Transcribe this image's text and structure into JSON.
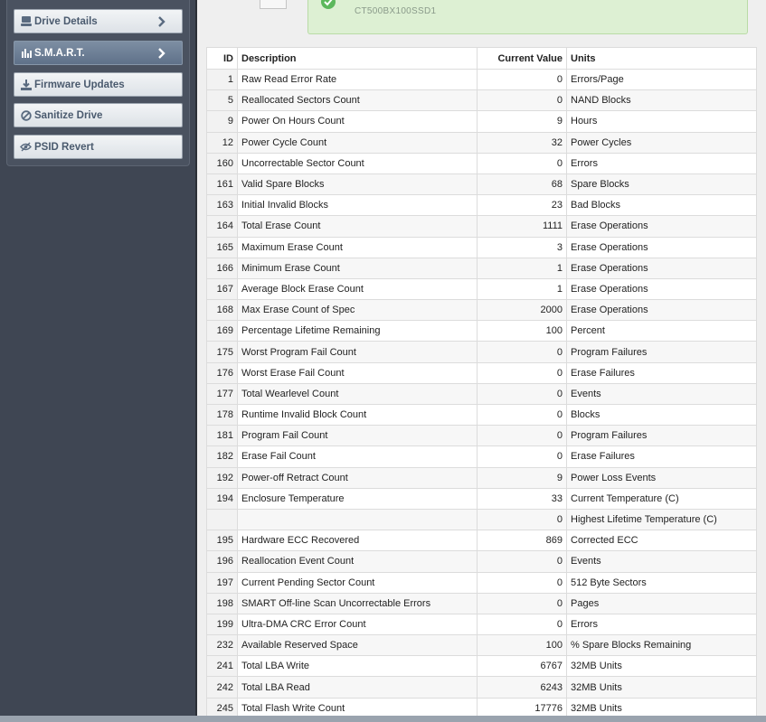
{
  "sidebar": {
    "items": [
      {
        "label": "Drive Details",
        "icon": "drive-icon",
        "has_chevron": true,
        "active": false
      },
      {
        "label": "S.M.A.R.T.",
        "icon": "bar-chart-icon",
        "has_chevron": true,
        "active": true
      },
      {
        "label": "Firmware Updates",
        "icon": "download-icon",
        "has_chevron": false,
        "active": false
      },
      {
        "label": "Sanitize Drive",
        "icon": "prohibited-icon",
        "has_chevron": false,
        "active": false
      },
      {
        "label": "PSID Revert",
        "icon": "eye-slash-icon",
        "has_chevron": false,
        "active": false
      }
    ]
  },
  "status": {
    "model": "CT500BX100SSD1",
    "color": "#ddf0d3"
  },
  "table": {
    "headers": {
      "id": "ID",
      "description": "Description",
      "value": "Current Value",
      "units": "Units"
    },
    "rows": [
      {
        "id": "1",
        "description": "Raw Read Error Rate",
        "value": "0",
        "units": "Errors/Page"
      },
      {
        "id": "5",
        "description": "Reallocated Sectors Count",
        "value": "0",
        "units": "NAND Blocks"
      },
      {
        "id": "9",
        "description": "Power On Hours Count",
        "value": "9",
        "units": "Hours"
      },
      {
        "id": "12",
        "description": "Power Cycle Count",
        "value": "32",
        "units": "Power Cycles"
      },
      {
        "id": "160",
        "description": "Uncorrectable Sector Count",
        "value": "0",
        "units": "Errors"
      },
      {
        "id": "161",
        "description": "Valid Spare Blocks",
        "value": "68",
        "units": "Spare Blocks"
      },
      {
        "id": "163",
        "description": "Initial Invalid Blocks",
        "value": "23",
        "units": "Bad Blocks"
      },
      {
        "id": "164",
        "description": "Total Erase Count",
        "value": "1111",
        "units": "Erase Operations"
      },
      {
        "id": "165",
        "description": "Maximum Erase Count",
        "value": "3",
        "units": "Erase Operations"
      },
      {
        "id": "166",
        "description": "Minimum Erase Count",
        "value": "1",
        "units": "Erase Operations"
      },
      {
        "id": "167",
        "description": "Average Block Erase Count",
        "value": "1",
        "units": "Erase Operations"
      },
      {
        "id": "168",
        "description": "Max Erase Count of Spec",
        "value": "2000",
        "units": "Erase Operations"
      },
      {
        "id": "169",
        "description": "Percentage Lifetime Remaining",
        "value": "100",
        "units": "Percent"
      },
      {
        "id": "175",
        "description": "Worst Program Fail Count",
        "value": "0",
        "units": "Program Failures"
      },
      {
        "id": "176",
        "description": "Worst Erase Fail Count",
        "value": "0",
        "units": "Erase Failures"
      },
      {
        "id": "177",
        "description": "Total Wearlevel Count",
        "value": "0",
        "units": "Events"
      },
      {
        "id": "178",
        "description": "Runtime Invalid Block Count",
        "value": "0",
        "units": "Blocks"
      },
      {
        "id": "181",
        "description": "Program Fail Count",
        "value": "0",
        "units": "Program Failures"
      },
      {
        "id": "182",
        "description": "Erase Fail Count",
        "value": "0",
        "units": "Erase Failures"
      },
      {
        "id": "192",
        "description": "Power-off Retract Count",
        "value": "9",
        "units": "Power Loss Events"
      },
      {
        "id": "194",
        "description": "Enclosure Temperature",
        "value": "33",
        "units": "Current Temperature (C)"
      },
      {
        "id": "",
        "description": "",
        "value": "0",
        "units": "Highest Lifetime Temperature (C)"
      },
      {
        "id": "195",
        "description": "Hardware ECC Recovered",
        "value": "869",
        "units": "Corrected ECC"
      },
      {
        "id": "196",
        "description": "Reallocation Event Count",
        "value": "0",
        "units": "Events"
      },
      {
        "id": "197",
        "description": "Current Pending Sector Count",
        "value": "0",
        "units": "512 Byte Sectors"
      },
      {
        "id": "198",
        "description": "SMART Off-line Scan Uncorrectable Errors",
        "value": "0",
        "units": "Pages"
      },
      {
        "id": "199",
        "description": "Ultra-DMA CRC Error Count",
        "value": "0",
        "units": "Errors"
      },
      {
        "id": "232",
        "description": "Available Reserved Space",
        "value": "100",
        "units": "% Spare Blocks Remaining"
      },
      {
        "id": "241",
        "description": "Total LBA Write",
        "value": "6767",
        "units": "32MB Units"
      },
      {
        "id": "242",
        "description": "Total LBA Read",
        "value": "6243",
        "units": "32MB Units"
      },
      {
        "id": "245",
        "description": "Total Flash Write Count",
        "value": "17776",
        "units": "32MB Units"
      }
    ]
  }
}
